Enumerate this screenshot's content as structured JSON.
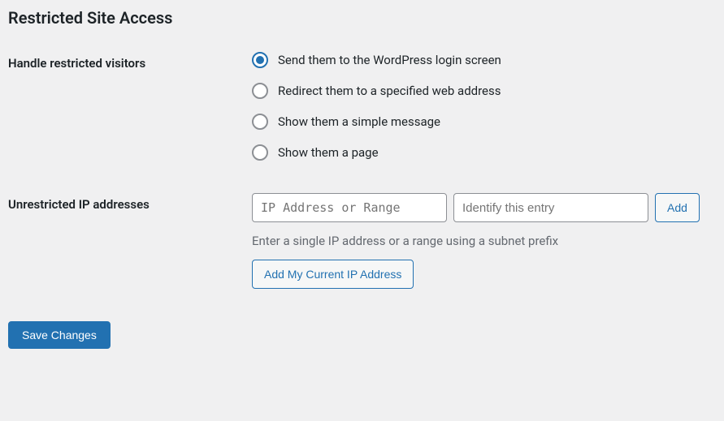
{
  "heading": "Restricted Site Access",
  "handle": {
    "label": "Handle restricted visitors",
    "options": [
      {
        "label": "Send them to the WordPress login screen",
        "checked": true
      },
      {
        "label": "Redirect them to a specified web address",
        "checked": false
      },
      {
        "label": "Show them a simple message",
        "checked": false
      },
      {
        "label": "Show them a page",
        "checked": false
      }
    ]
  },
  "ip": {
    "label": "Unrestricted IP addresses",
    "placeholder_ip": "IP Address or Range",
    "placeholder_identify": "Identify this entry",
    "add_label": "Add",
    "description": "Enter a single IP address or a range using a subnet prefix",
    "add_my_ip_label": "Add My Current IP Address"
  },
  "save_label": "Save Changes"
}
